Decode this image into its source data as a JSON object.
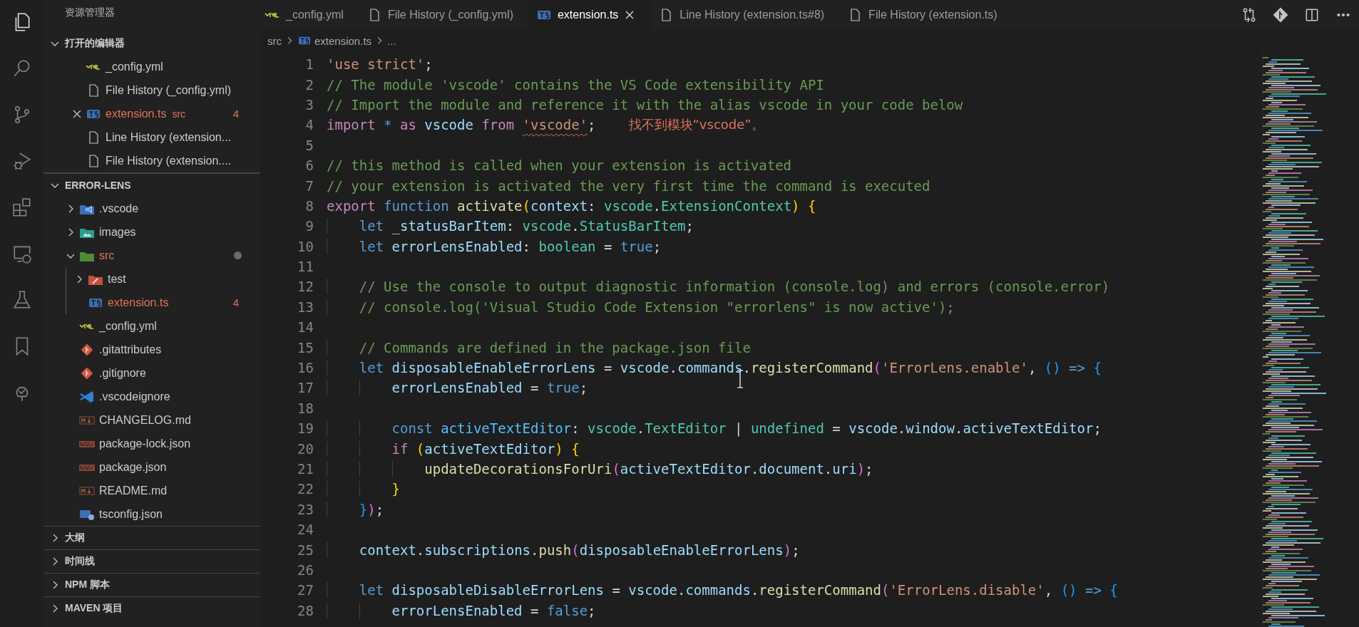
{
  "activity_bar": [
    {
      "kind": "explorer",
      "selected": true
    },
    {
      "kind": "search",
      "selected": false
    },
    {
      "kind": "source-control",
      "selected": false
    },
    {
      "kind": "run-debug",
      "selected": false
    },
    {
      "kind": "extensions",
      "selected": false
    },
    {
      "kind": "remote",
      "selected": false
    },
    {
      "kind": "testing",
      "selected": false
    },
    {
      "kind": "bookmarks",
      "selected": false
    },
    {
      "kind": "tree",
      "selected": false
    }
  ],
  "sidebar": {
    "title": "资源管理器",
    "sections": [
      {
        "kind": "open-editors",
        "title": "打开的编辑器",
        "expanded": true,
        "items": [
          {
            "kind": "yaml",
            "name": "_config.yml",
            "error": false,
            "hovered": false
          },
          {
            "kind": "file",
            "name": "File History (_config.yml)",
            "error": false,
            "hovered": false
          },
          {
            "kind": "ts",
            "name": "extension.ts",
            "description": "src",
            "badge": "4",
            "error": true,
            "hovered": true
          },
          {
            "kind": "file",
            "name": "Line History (extension...",
            "error": false,
            "hovered": false
          },
          {
            "kind": "file",
            "name": "File History (extension....",
            "error": false,
            "hovered": false
          }
        ]
      },
      {
        "kind": "tree",
        "title": "ERROR-LENS",
        "expanded": true,
        "items": [
          {
            "kind": "vscode-folder",
            "name": ".vscode",
            "expanded": false,
            "error": false
          },
          {
            "kind": "images-folder",
            "name": "images",
            "expanded": false,
            "error": false
          },
          {
            "kind": "src-folder",
            "name": "src",
            "expanded": true,
            "error": true,
            "modified": true,
            "children": [
              {
                "kind": "test-folder",
                "name": "test",
                "expanded": false,
                "error": false
              },
              {
                "kind": "ts",
                "name": "extension.ts",
                "badge": "4",
                "error": true
              }
            ]
          },
          {
            "kind": "yaml",
            "name": "_config.yml",
            "error": false
          },
          {
            "kind": "git",
            "name": ".gitattributes",
            "error": false
          },
          {
            "kind": "git",
            "name": ".gitignore",
            "error": false
          },
          {
            "kind": "vscode",
            "name": ".vscodeignore",
            "error": false
          },
          {
            "kind": "markdown",
            "name": "CHANGELOG.md",
            "error": false
          },
          {
            "kind": "npm",
            "name": "package-lock.json",
            "error": false
          },
          {
            "kind": "npm",
            "name": "package.json",
            "error": false
          },
          {
            "kind": "markdown",
            "name": "README.md",
            "error": false
          },
          {
            "kind": "tsconfig",
            "name": "tsconfig.json",
            "error": false
          }
        ]
      },
      {
        "kind": "panel",
        "title": "大纲",
        "expanded": false
      },
      {
        "kind": "panel",
        "title": "时间线",
        "expanded": false
      },
      {
        "kind": "panel",
        "title": "NPM 脚本",
        "expanded": false
      },
      {
        "kind": "panel",
        "title": "MAVEN 项目",
        "expanded": false
      }
    ]
  },
  "tabs": [
    {
      "kind": "yaml",
      "label": "_config.yml",
      "selected": false
    },
    {
      "kind": "file",
      "label": "File History (_config.yml)",
      "selected": false
    },
    {
      "kind": "ts",
      "label": "extension.ts",
      "selected": true
    },
    {
      "kind": "file",
      "label": "Line History (extension.ts#8)",
      "selected": false
    },
    {
      "kind": "file",
      "label": "File History (extension.ts)",
      "selected": false
    }
  ],
  "tab_actions": [
    {
      "kind": "compare"
    },
    {
      "kind": "git"
    },
    {
      "kind": "split"
    },
    {
      "kind": "more"
    }
  ],
  "breadcrumbs": [
    {
      "kind": "folder",
      "label": "src"
    },
    {
      "kind": "ts",
      "label": "extension.ts"
    },
    {
      "kind": "symbol",
      "label": "..."
    }
  ],
  "editor": {
    "lines": [
      {
        "number": "1",
        "tokens": [
          {
            "kind": "string",
            "text": "'use strict'"
          },
          {
            "kind": "plain",
            "text": ";"
          }
        ]
      },
      {
        "number": "2",
        "tokens": [
          {
            "kind": "comment",
            "text": "// The module 'vscode' contains the VS Code extensibility API"
          }
        ]
      },
      {
        "number": "3",
        "tokens": [
          {
            "kind": "comment",
            "text": "// Import the module and reference it with the alias vscode in your code below"
          }
        ]
      },
      {
        "number": "4",
        "diagnostic": "找不到模块“vscode”。",
        "tokens": [
          {
            "kind": "control",
            "text": "import "
          },
          {
            "kind": "keyword",
            "text": "* "
          },
          {
            "kind": "control",
            "text": "as "
          },
          {
            "kind": "variable",
            "text": "vscode "
          },
          {
            "kind": "control",
            "text": "from "
          },
          {
            "kind": "string-error",
            "text": "'vscode'"
          },
          {
            "kind": "plain",
            "text": ";"
          }
        ]
      },
      {
        "number": "5"
      },
      {
        "number": "6",
        "tokens": [
          {
            "kind": "comment",
            "text": "// this method is called when your extension is activated"
          }
        ]
      },
      {
        "number": "7",
        "tokens": [
          {
            "kind": "comment",
            "text": "// your extension is activated the very first time the command is executed"
          }
        ]
      },
      {
        "number": "8",
        "tokens": [
          {
            "kind": "control",
            "text": "export "
          },
          {
            "kind": "keyword",
            "text": "function "
          },
          {
            "kind": "function",
            "text": "activate"
          },
          {
            "kind": "bracket1",
            "text": "("
          },
          {
            "kind": "variable",
            "text": "context"
          },
          {
            "kind": "plain",
            "text": ": "
          },
          {
            "kind": "type",
            "text": "vscode"
          },
          {
            "kind": "plain",
            "text": "."
          },
          {
            "kind": "type",
            "text": "ExtensionContext"
          },
          {
            "kind": "bracket1",
            "text": ") "
          },
          {
            "kind": "bracket1",
            "text": "{"
          }
        ]
      },
      {
        "number": "9",
        "tokens": [
          {
            "kind": "keyword",
            "text": "    let "
          },
          {
            "kind": "variable",
            "text": "_statusBarItem"
          },
          {
            "kind": "plain",
            "text": ": "
          },
          {
            "kind": "type",
            "text": "vscode"
          },
          {
            "kind": "plain",
            "text": "."
          },
          {
            "kind": "type",
            "text": "StatusBarItem"
          },
          {
            "kind": "plain",
            "text": ";"
          }
        ]
      },
      {
        "number": "10",
        "tokens": [
          {
            "kind": "keyword",
            "text": "    let "
          },
          {
            "kind": "variable",
            "text": "errorLensEnabled"
          },
          {
            "kind": "plain",
            "text": ": "
          },
          {
            "kind": "type",
            "text": "boolean"
          },
          {
            "kind": "plain",
            "text": " = "
          },
          {
            "kind": "keyword",
            "text": "true"
          },
          {
            "kind": "plain",
            "text": ";"
          }
        ]
      },
      {
        "number": "11"
      },
      {
        "number": "12",
        "tokens": [
          {
            "kind": "comment",
            "text": "    // Use the console to output diagnostic information (console.log) and errors (console.error)"
          }
        ]
      },
      {
        "number": "13",
        "tokens": [
          {
            "kind": "comment",
            "text": "    // console.log('Visual Studio Code Extension \"errorlens\" is now active');"
          }
        ]
      },
      {
        "number": "14"
      },
      {
        "number": "15",
        "tokens": [
          {
            "kind": "comment",
            "text": "    // Commands are defined in the package.json file"
          }
        ]
      },
      {
        "number": "16",
        "tokens": [
          {
            "kind": "keyword",
            "text": "    let "
          },
          {
            "kind": "variable",
            "text": "disposableEnableErrorLens"
          },
          {
            "kind": "plain",
            "text": " = "
          },
          {
            "kind": "variable",
            "text": "vscode"
          },
          {
            "kind": "plain",
            "text": "."
          },
          {
            "kind": "variable",
            "text": "commands"
          },
          {
            "kind": "plain",
            "text": "."
          },
          {
            "kind": "function",
            "text": "registerCommand"
          },
          {
            "kind": "bracket2",
            "text": "("
          },
          {
            "kind": "string",
            "text": "'ErrorLens.enable'"
          },
          {
            "kind": "plain",
            "text": ", "
          },
          {
            "kind": "bracket3",
            "text": "() "
          },
          {
            "kind": "keyword",
            "text": "=> "
          },
          {
            "kind": "bracket3",
            "text": "{"
          }
        ]
      },
      {
        "number": "17",
        "tokens": [
          {
            "kind": "variable",
            "text": "        errorLensEnabled"
          },
          {
            "kind": "plain",
            "text": " = "
          },
          {
            "kind": "keyword",
            "text": "true"
          },
          {
            "kind": "plain",
            "text": ";"
          }
        ]
      },
      {
        "number": "18"
      },
      {
        "number": "19",
        "tokens": [
          {
            "kind": "keyword",
            "text": "        const "
          },
          {
            "kind": "constant",
            "text": "activeTextEditor"
          },
          {
            "kind": "plain",
            "text": ": "
          },
          {
            "kind": "type",
            "text": "vscode"
          },
          {
            "kind": "plain",
            "text": "."
          },
          {
            "kind": "type",
            "text": "TextEditor"
          },
          {
            "kind": "plain",
            "text": " | "
          },
          {
            "kind": "type",
            "text": "undefined"
          },
          {
            "kind": "plain",
            "text": " = "
          },
          {
            "kind": "variable",
            "text": "vscode"
          },
          {
            "kind": "plain",
            "text": "."
          },
          {
            "kind": "variable",
            "text": "window"
          },
          {
            "kind": "plain",
            "text": "."
          },
          {
            "kind": "variable",
            "text": "activeTextEditor"
          },
          {
            "kind": "plain",
            "text": ";"
          }
        ]
      },
      {
        "number": "20",
        "tokens": [
          {
            "kind": "control",
            "text": "        if "
          },
          {
            "kind": "bracket1",
            "text": "("
          },
          {
            "kind": "variable",
            "text": "activeTextEditor"
          },
          {
            "kind": "bracket1",
            "text": ") "
          },
          {
            "kind": "bracket1",
            "text": "{"
          }
        ]
      },
      {
        "number": "21",
        "tokens": [
          {
            "kind": "function",
            "text": "            updateDecorationsForUri"
          },
          {
            "kind": "bracket2",
            "text": "("
          },
          {
            "kind": "variable",
            "text": "activeTextEditor"
          },
          {
            "kind": "plain",
            "text": "."
          },
          {
            "kind": "variable",
            "text": "document"
          },
          {
            "kind": "plain",
            "text": "."
          },
          {
            "kind": "variable",
            "text": "uri"
          },
          {
            "kind": "bracket2",
            "text": ")"
          },
          {
            "kind": "plain",
            "text": ";"
          }
        ]
      },
      {
        "number": "22",
        "tokens": [
          {
            "kind": "bracket1",
            "text": "        }"
          }
        ]
      },
      {
        "number": "23",
        "tokens": [
          {
            "kind": "bracket3",
            "text": "    }"
          },
          {
            "kind": "bracket2",
            "text": ")"
          },
          {
            "kind": "plain",
            "text": ";"
          }
        ]
      },
      {
        "number": "24"
      },
      {
        "number": "25",
        "tokens": [
          {
            "kind": "variable",
            "text": "    context"
          },
          {
            "kind": "plain",
            "text": "."
          },
          {
            "kind": "variable",
            "text": "subscriptions"
          },
          {
            "kind": "plain",
            "text": "."
          },
          {
            "kind": "function",
            "text": "push"
          },
          {
            "kind": "bracket2",
            "text": "("
          },
          {
            "kind": "variable",
            "text": "disposableEnableErrorLens"
          },
          {
            "kind": "bracket2",
            "text": ")"
          },
          {
            "kind": "plain",
            "text": ";"
          }
        ]
      },
      {
        "number": "26"
      },
      {
        "number": "27",
        "tokens": [
          {
            "kind": "keyword",
            "text": "    let "
          },
          {
            "kind": "variable",
            "text": "disposableDisableErrorLens"
          },
          {
            "kind": "plain",
            "text": " = "
          },
          {
            "kind": "variable",
            "text": "vscode"
          },
          {
            "kind": "plain",
            "text": "."
          },
          {
            "kind": "variable",
            "text": "commands"
          },
          {
            "kind": "plain",
            "text": "."
          },
          {
            "kind": "function",
            "text": "registerCommand"
          },
          {
            "kind": "bracket2",
            "text": "("
          },
          {
            "kind": "string",
            "text": "'ErrorLens.disable'"
          },
          {
            "kind": "plain",
            "text": ", "
          },
          {
            "kind": "bracket3",
            "text": "() "
          },
          {
            "kind": "keyword",
            "text": "=> "
          },
          {
            "kind": "bracket3",
            "text": "{"
          }
        ]
      },
      {
        "number": "28",
        "tokens": [
          {
            "kind": "variable",
            "text": "        errorLensEnabled"
          },
          {
            "kind": "plain",
            "text": " = "
          },
          {
            "kind": "keyword",
            "text": "false"
          },
          {
            "kind": "plain",
            "text": ";"
          }
        ]
      }
    ]
  }
}
